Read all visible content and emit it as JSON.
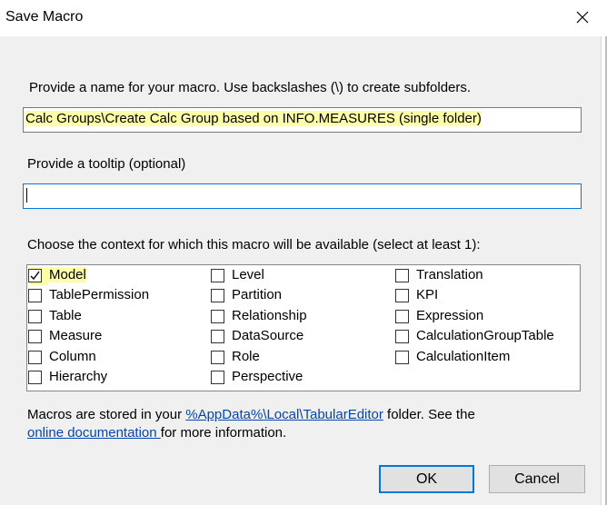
{
  "window": {
    "title": "Save Macro",
    "close_icon": "close-icon"
  },
  "name_prompt": "Provide a name for your macro. Use backslashes (\\) to create subfolders.",
  "name_value": "Calc Groups\\Create Calc Group based on INFO.MEASURES (single folder)",
  "tooltip_prompt": "Provide a tooltip (optional)",
  "tooltip_value": "",
  "context_prompt": "Choose the context for which this macro will be available (select at least 1):",
  "contexts": [
    {
      "label": "Model",
      "checked": true
    },
    {
      "label": "TablePermission",
      "checked": false
    },
    {
      "label": "Table",
      "checked": false
    },
    {
      "label": "Measure",
      "checked": false
    },
    {
      "label": "Column",
      "checked": false
    },
    {
      "label": "Hierarchy",
      "checked": false
    },
    {
      "label": "Level",
      "checked": false
    },
    {
      "label": "Partition",
      "checked": false
    },
    {
      "label": "Relationship",
      "checked": false
    },
    {
      "label": "DataSource",
      "checked": false
    },
    {
      "label": "Role",
      "checked": false
    },
    {
      "label": "Perspective",
      "checked": false
    },
    {
      "label": "Translation",
      "checked": false
    },
    {
      "label": "KPI",
      "checked": false
    },
    {
      "label": "Expression",
      "checked": false
    },
    {
      "label": "CalculationGroupTable",
      "checked": false
    },
    {
      "label": "CalculationItem",
      "checked": false
    }
  ],
  "footer": {
    "line1_prefix": "Macros are stored in your ",
    "path_link": "%AppData%\\Local\\TabularEditor",
    "line1_suffix": " folder. See the",
    "line2_prefix": "o",
    "doc_link": "nline documentation ",
    "line2_suffix": "for more information."
  },
  "buttons": {
    "ok": "OK",
    "cancel": "Cancel"
  },
  "colors": {
    "highlight": "#ffffa8",
    "link": "#0645ad",
    "focus_border": "#0078d7"
  }
}
